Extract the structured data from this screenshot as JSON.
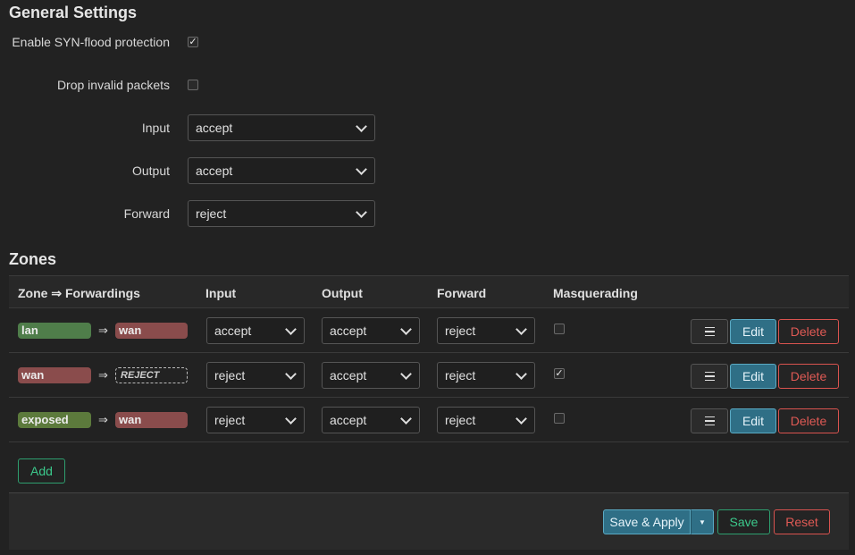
{
  "general": {
    "title": "General Settings",
    "syn_flood_label": "Enable SYN-flood protection",
    "syn_flood_checked": true,
    "drop_invalid_label": "Drop invalid packets",
    "drop_invalid_checked": false,
    "input_label": "Input",
    "input_value": "accept",
    "output_label": "Output",
    "output_value": "accept",
    "forward_label": "Forward",
    "forward_value": "reject"
  },
  "zones": {
    "title": "Zones",
    "headers": {
      "zone": "Zone ⇒ Forwardings",
      "input": "Input",
      "output": "Output",
      "forward": "Forward",
      "masq": "Masquerading"
    },
    "rows": [
      {
        "zone": "lan",
        "zone_color": "#4f7d4a",
        "arrow": "⇒",
        "fwd": "wan",
        "fwd_color": "#8a4c4c",
        "fwd_dashed": false,
        "input": "accept",
        "output": "accept",
        "forward": "reject",
        "masq": false
      },
      {
        "zone": "wan",
        "zone_color": "#8a4c4c",
        "arrow": "⇒",
        "fwd": "REJECT",
        "fwd_color": "",
        "fwd_dashed": true,
        "input": "reject",
        "output": "accept",
        "forward": "reject",
        "masq": true
      },
      {
        "zone": "exposed",
        "zone_color": "#5c7a3c",
        "arrow": "⇒",
        "fwd": "wan",
        "fwd_color": "#8a4c4c",
        "fwd_dashed": false,
        "input": "reject",
        "output": "accept",
        "forward": "reject",
        "masq": false
      }
    ],
    "row_buttons": {
      "menu_icon": "hamburger-icon",
      "edit": "Edit",
      "delete": "Delete"
    },
    "add_label": "Add"
  },
  "footer": {
    "save_apply": "Save & Apply",
    "dropdown_icon": "caret-down-icon",
    "save": "Save",
    "reset": "Reset"
  },
  "colors": {
    "accent_blue": "#2f6f86",
    "accent_green": "#3cc98c",
    "accent_red": "#e05a55"
  }
}
